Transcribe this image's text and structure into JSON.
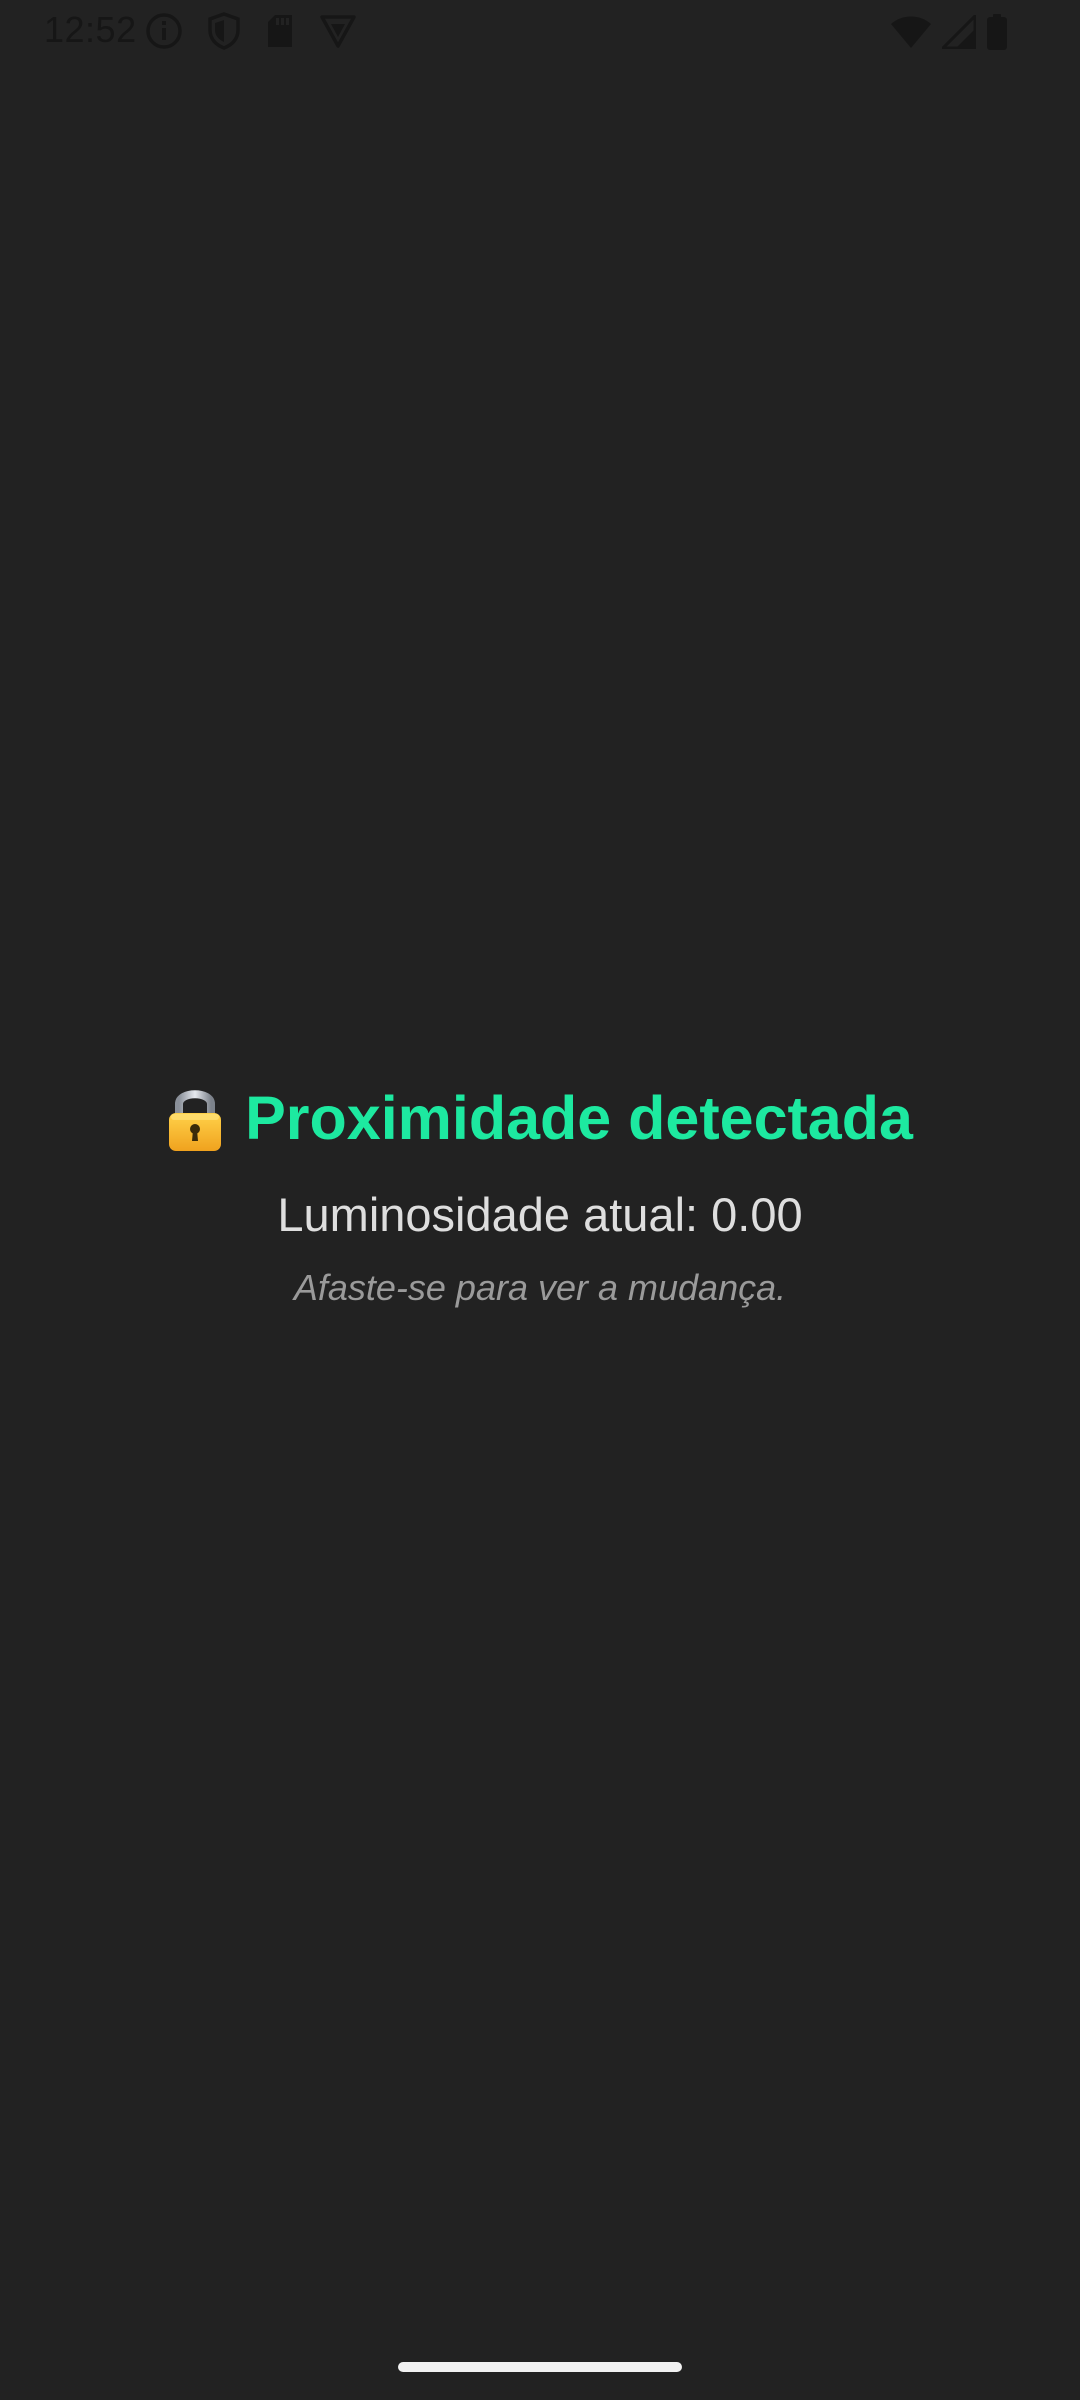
{
  "status_bar": {
    "time": "12:52",
    "left_icons": [
      "info-icon",
      "shield-icon",
      "sd-card-icon",
      "vpn-icon"
    ],
    "right_icons": [
      "wifi-icon",
      "cellular-signal-icon",
      "battery-icon"
    ]
  },
  "main": {
    "icon": "lock-icon",
    "title": "Proximidade detectada",
    "luminosity_text": "Luminosidade atual: 0.00",
    "hint": "Afaste-se para ver a mudança."
  },
  "colors": {
    "background": "#222222",
    "accent": "#1de9a0",
    "primary_text": "#dedede",
    "secondary_text": "#9a9a9a"
  }
}
